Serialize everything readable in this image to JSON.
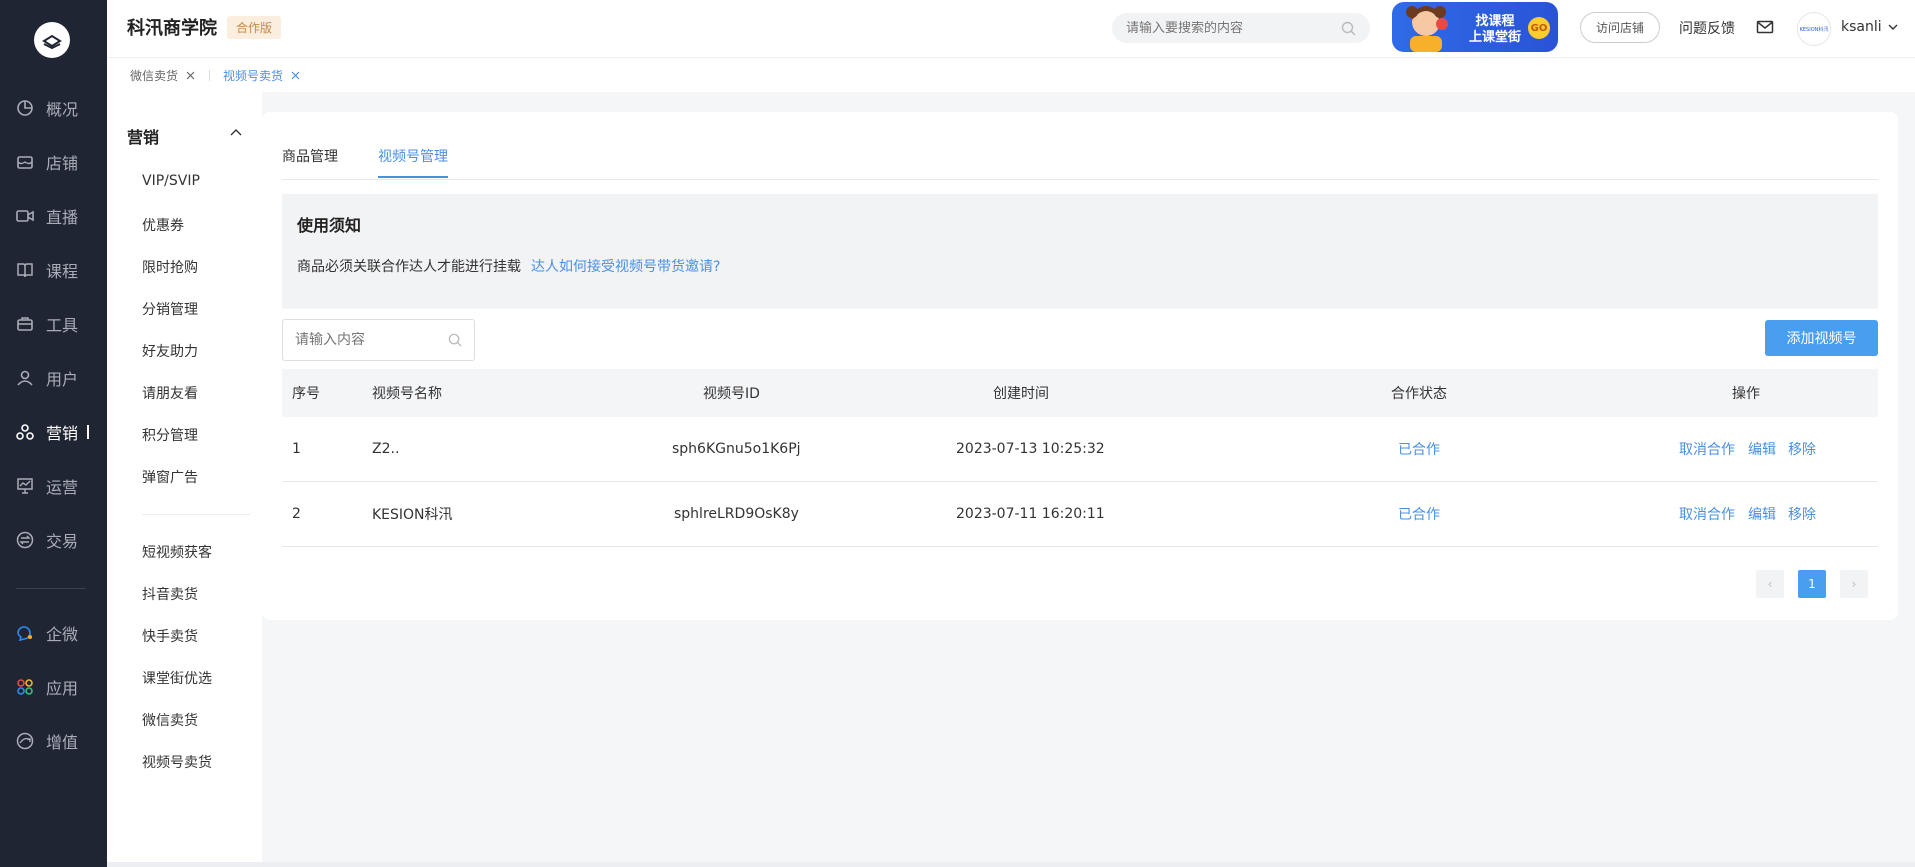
{
  "rail": {
    "items": [
      {
        "label": "概况",
        "icon": "pie-chart-icon"
      },
      {
        "label": "店铺",
        "icon": "store-icon"
      },
      {
        "label": "直播",
        "icon": "video-camera-icon"
      },
      {
        "label": "课程",
        "icon": "book-icon"
      },
      {
        "label": "工具",
        "icon": "toolbox-icon"
      },
      {
        "label": "用户",
        "icon": "user-icon"
      },
      {
        "label": "营销",
        "icon": "marketing-icon"
      },
      {
        "label": "运营",
        "icon": "presentation-icon"
      },
      {
        "label": "交易",
        "icon": "exchange-icon"
      },
      {
        "label": "企微",
        "icon": "wecom-icon"
      },
      {
        "label": "应用",
        "icon": "apps-icon"
      },
      {
        "label": "增值",
        "icon": "value-added-icon"
      }
    ],
    "active_index": 6
  },
  "header": {
    "brand": "科汛商学院",
    "edition": "合作版",
    "search_placeholder": "请输入要搜索的内容",
    "banner_line1": "找课程",
    "banner_line2": "上课堂街",
    "banner_go": "GO",
    "visit_store": "访问店铺",
    "feedback": "问题反馈",
    "avatar_text": "KESION科汛",
    "username": "ksanli"
  },
  "tabbar": {
    "tabs": [
      {
        "label": "微信卖货",
        "active": false
      },
      {
        "label": "视频号卖货",
        "active": true
      }
    ]
  },
  "subside": {
    "title": "营销",
    "group1": [
      "VIP/SVIP",
      "优惠券",
      "限时抢购",
      "分销管理",
      "好友助力",
      "请朋友看",
      "积分管理",
      "弹窗广告"
    ],
    "group2": [
      "短视频获客",
      "抖音卖货",
      "快手卖货",
      "课堂街优选",
      "微信卖货",
      "视频号卖货"
    ]
  },
  "main": {
    "tabs": [
      {
        "label": "商品管理",
        "active": false
      },
      {
        "label": "视频号管理",
        "active": true
      }
    ],
    "notice": {
      "title": "使用须知",
      "text": "商品必须关联合作达人才能进行挂载",
      "link": "达人如何接受视频号带货邀请?"
    },
    "search_placeholder": "请输入内容",
    "add_button": "添加视频号",
    "table": {
      "columns": [
        "序号",
        "视频号名称",
        "视频号ID",
        "创建时间",
        "合作状态",
        "操作"
      ],
      "rows": [
        {
          "index": "1",
          "name": "Z2..",
          "id": "sph6KGnu5o1K6Pj",
          "created": "2023-07-13 10:25:32",
          "status": "已合作",
          "actions": [
            "取消合作",
            "编辑",
            "移除"
          ]
        },
        {
          "index": "2",
          "name": "KESION科汛",
          "id": "sphlreLRD9OsK8y",
          "created": "2023-07-11 16:20:11",
          "status": "已合作",
          "actions": [
            "取消合作",
            "编辑",
            "移除"
          ]
        }
      ]
    },
    "pagination": {
      "current": "1",
      "prev": "‹",
      "next": "›"
    }
  },
  "colors": {
    "accent": "#4a90e2",
    "rail_bg": "#1f2533",
    "button": "#4a9ef0"
  }
}
